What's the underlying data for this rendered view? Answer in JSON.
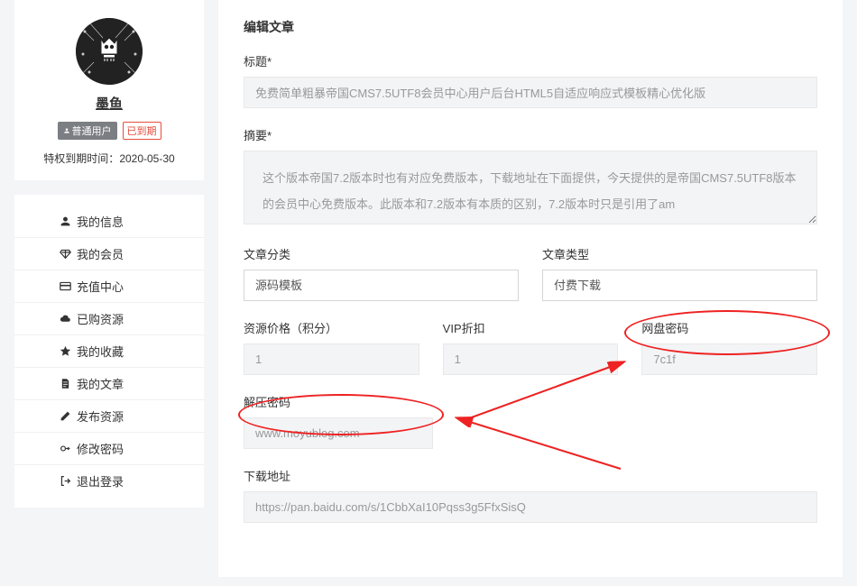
{
  "profile": {
    "username": "墨鱼",
    "badge_user": "普通用户",
    "badge_expired": "已到期",
    "expire_label": "特权到期时间：",
    "expire_date": "2020-05-30"
  },
  "nav": [
    {
      "icon": "user",
      "label": "我的信息"
    },
    {
      "icon": "diamond",
      "label": "我的会员"
    },
    {
      "icon": "card",
      "label": "充值中心"
    },
    {
      "icon": "cloud",
      "label": "已购资源"
    },
    {
      "icon": "star",
      "label": "我的收藏"
    },
    {
      "icon": "file",
      "label": "我的文章"
    },
    {
      "icon": "edit",
      "label": "发布资源"
    },
    {
      "icon": "key",
      "label": "修改密码"
    },
    {
      "icon": "logout",
      "label": "退出登录"
    }
  ],
  "main": {
    "title": "编辑文章",
    "fields": {
      "title": {
        "label": "标题*",
        "value": "免费简单粗暴帝国CMS7.5UTF8会员中心用户后台HTML5自适应响应式模板精心优化版"
      },
      "summary": {
        "label": "摘要*",
        "value": "这个版本帝国7.2版本时也有对应免费版本，下载地址在下面提供，今天提供的是帝国CMS7.5UTF8版本的会员中心免费版本。此版本和7.2版本有本质的区别，7.2版本时只是引用了am"
      },
      "category": {
        "label": "文章分类",
        "value": "源码模板"
      },
      "type": {
        "label": "文章类型",
        "value": "付费下载"
      },
      "price": {
        "label": "资源价格（积分）",
        "value": "1"
      },
      "vip_discount": {
        "label": "VIP折扣",
        "value": "1"
      },
      "pan_password": {
        "label": "网盘密码",
        "value": "7c1f"
      },
      "unzip_password": {
        "label": "解压密码",
        "value": "www.moyublog.com"
      },
      "download_url": {
        "label": "下载地址",
        "value": "https://pan.baidu.com/s/1CbbXaI10Pqss3g5FfxSisQ"
      }
    }
  }
}
